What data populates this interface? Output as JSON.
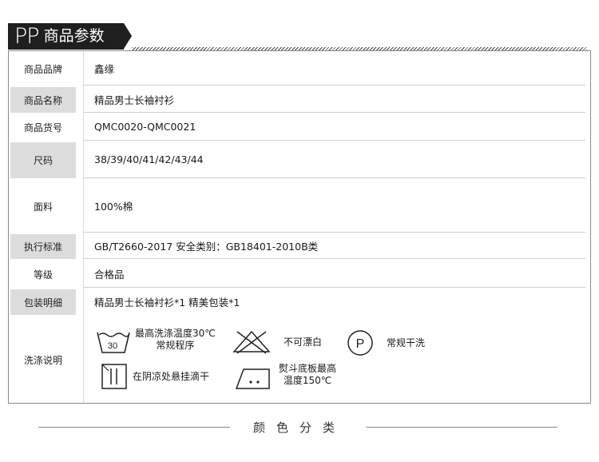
{
  "header": {
    "prefix": "PP",
    "title": "商品参数"
  },
  "rows": [
    {
      "label": "商品品牌",
      "value": "鑫缘"
    },
    {
      "label": "商品名称",
      "value": "精品男士长袖衬衫"
    },
    {
      "label": "商品货号",
      "value": "QMC0020-QMC0021"
    },
    {
      "label": "尺码",
      "value": "38/39/40/41/42/43/44"
    },
    {
      "label": "面料",
      "value": "100%棉"
    },
    {
      "label": "执行标准",
      "value": "GB/T2660-2017  安全类别：GB18401-2010B类"
    },
    {
      "label": "等级",
      "value": "合格品"
    },
    {
      "label": "包装明细",
      "value": "精品男士长袖衬衫*1   精美包装*1"
    },
    {
      "label": "洗涤说明",
      "value": ""
    }
  ],
  "care": {
    "wash_temp": "30",
    "wash_line1": "最高洗涤温度30℃",
    "wash_line2": "常规程序",
    "no_bleach": "不可漂白",
    "dryclean_letter": "P",
    "dryclean": "常规干洗",
    "shade_dry": "在阴凉处悬挂滴干",
    "iron_line1": "熨斗底板最高",
    "iron_line2": "温度150℃"
  },
  "footer": {
    "title": "颜色分类"
  }
}
